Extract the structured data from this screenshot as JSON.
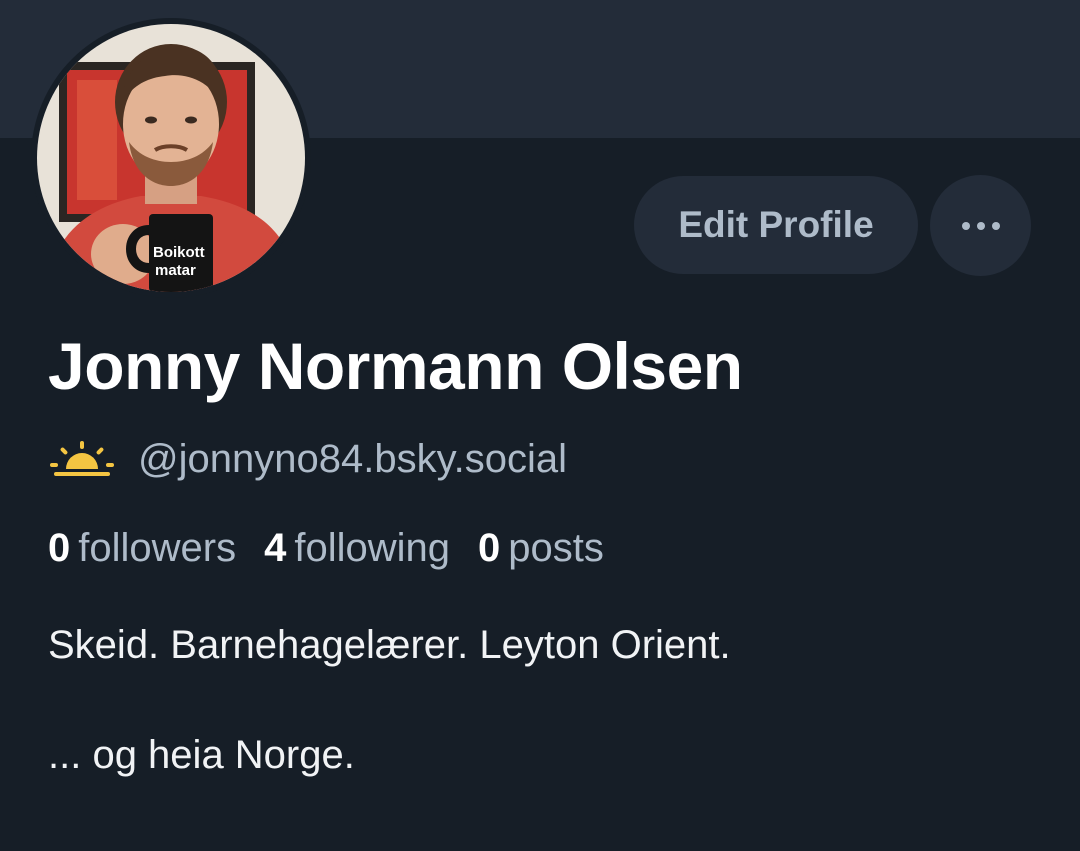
{
  "profile": {
    "display_name": "Jonny Normann Olsen",
    "handle": "@jonnyno84.bsky.social",
    "handle_icon": "sunrise-icon",
    "mug_text_1": "Boikott",
    "mug_text_2": "matar"
  },
  "actions": {
    "edit_label": "Edit Profile",
    "more_icon": "ellipsis-icon"
  },
  "stats": [
    {
      "count": "0",
      "label": "followers"
    },
    {
      "count": "4",
      "label": "following"
    },
    {
      "count": "0",
      "label": "posts"
    }
  ],
  "bio": {
    "line1": "Skeid. Barnehagelærer. Leyton Orient.",
    "line2": "... og heia Norge."
  },
  "colors": {
    "background": "#161e27",
    "banner": "#232c39",
    "button": "#232c39",
    "muted_text": "#aebbc9",
    "sun": "#f4c542"
  }
}
